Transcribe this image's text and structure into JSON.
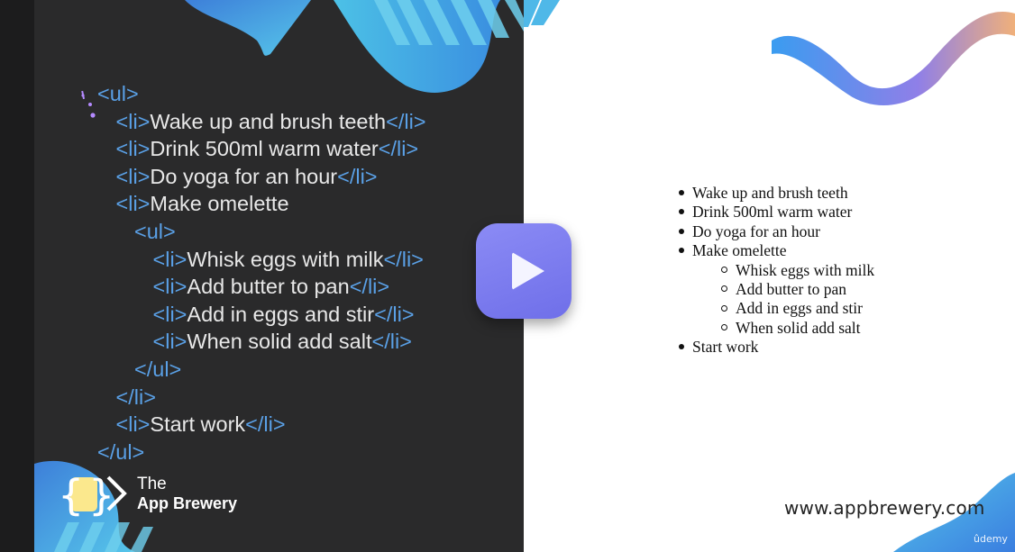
{
  "code_lines": [
    {
      "indent": 0,
      "open": "<ul>",
      "text": "",
      "close": ""
    },
    {
      "indent": 1,
      "open": "<li>",
      "text": "Wake up and brush teeth",
      "close": "</li>"
    },
    {
      "indent": 1,
      "open": "<li>",
      "text": "Drink 500ml warm water",
      "close": "</li>"
    },
    {
      "indent": 1,
      "open": "<li>",
      "text": "Do yoga for an hour",
      "close": "</li>"
    },
    {
      "indent": 1,
      "open": "<li>",
      "text": "Make omelette",
      "close": ""
    },
    {
      "indent": 2,
      "open": "<ul>",
      "text": "",
      "close": ""
    },
    {
      "indent": 3,
      "open": "<li>",
      "text": "Whisk eggs with milk",
      "close": "</li>"
    },
    {
      "indent": 3,
      "open": "<li>",
      "text": "Add butter to pan",
      "close": "</li>"
    },
    {
      "indent": 3,
      "open": "<li>",
      "text": "Add in eggs and stir",
      "close": "</li>"
    },
    {
      "indent": 3,
      "open": "<li>",
      "text": "When solid add salt",
      "close": "</li>"
    },
    {
      "indent": 2,
      "open": "</ul>",
      "text": "",
      "close": ""
    },
    {
      "indent": 1,
      "open": "</li>",
      "text": "",
      "close": ""
    },
    {
      "indent": 1,
      "open": "<li>",
      "text": "Start work",
      "close": "</li>"
    },
    {
      "indent": 0,
      "open": "</ul>",
      "text": "",
      "close": ""
    }
  ],
  "rendered_list": [
    {
      "level": 0,
      "text": "Wake up and brush teeth"
    },
    {
      "level": 0,
      "text": "Drink 500ml warm water"
    },
    {
      "level": 0,
      "text": "Do yoga for an hour"
    },
    {
      "level": 0,
      "text": "Make omelette"
    },
    {
      "level": 1,
      "text": "Whisk eggs with milk"
    },
    {
      "level": 1,
      "text": "Add butter to pan"
    },
    {
      "level": 1,
      "text": "Add in eggs and stir"
    },
    {
      "level": 1,
      "text": "When solid add salt"
    },
    {
      "level": 0,
      "text": "Start work"
    }
  ],
  "brand": {
    "line1": "The",
    "line2": "App Brewery"
  },
  "website": "www.appbrewery.com",
  "watermark": "ûdemy",
  "colors": {
    "left_bg": "#2a2a2b",
    "tag": "#5aa0e6",
    "play": "#7b7bef",
    "wave": "#4fb8e8"
  },
  "icons": {
    "play": "play-icon",
    "logo": "braces-cup-logo-icon"
  }
}
